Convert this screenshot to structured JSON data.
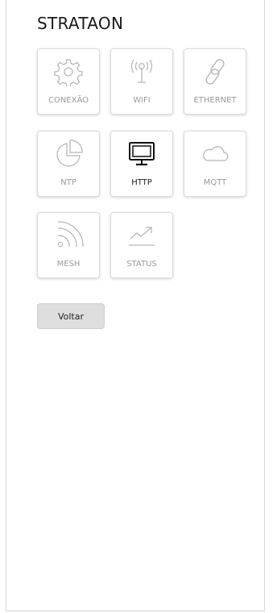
{
  "app": {
    "title": "STRATAON"
  },
  "tiles": [
    {
      "label": "CONEXÃO",
      "icon": "gear-icon"
    },
    {
      "label": "WIFI",
      "icon": "antenna-icon"
    },
    {
      "label": "ETHERNET",
      "icon": "link-icon"
    },
    {
      "label": "NTP",
      "icon": "pie-chart-icon"
    },
    {
      "label": "HTTP",
      "icon": "monitor-icon",
      "active": true
    },
    {
      "label": "MQTT",
      "icon": "cloud-icon"
    },
    {
      "label": "MESH",
      "icon": "mesh-signal-icon"
    },
    {
      "label": "STATUS",
      "icon": "trend-up-icon"
    }
  ],
  "actions": {
    "back_label": "Voltar"
  },
  "colors": {
    "icon_inactive": "#b8b8b8",
    "icon_active": "#111111",
    "button_bg": "#dedede"
  }
}
